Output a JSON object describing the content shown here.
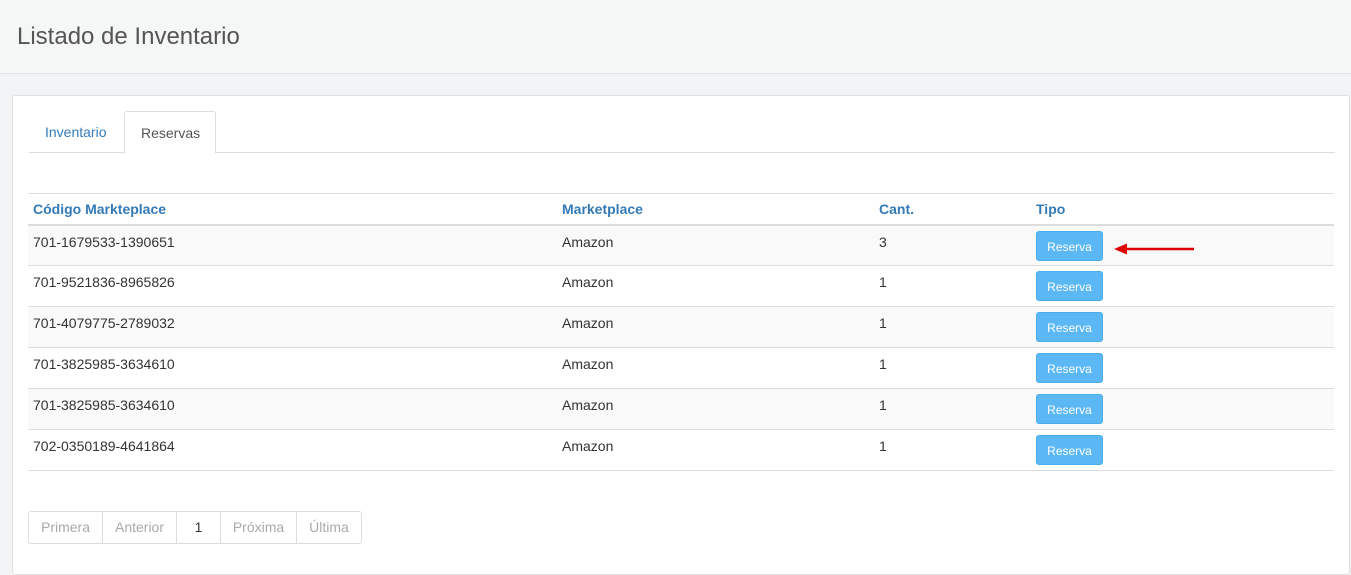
{
  "header": {
    "title": "Listado de Inventario"
  },
  "tabs": [
    {
      "label": "Inventario",
      "active": false
    },
    {
      "label": "Reservas",
      "active": true
    }
  ],
  "table": {
    "columns": [
      "Código Markteplace",
      "Marketplace",
      "Cant.",
      "Tipo"
    ],
    "rows": [
      {
        "code": "701-1679533-1390651",
        "marketplace": "Amazon",
        "qty": "3",
        "type": "Reserva"
      },
      {
        "code": "701-9521836-8965826",
        "marketplace": "Amazon",
        "qty": "1",
        "type": "Reserva"
      },
      {
        "code": "701-4079775-2789032",
        "marketplace": "Amazon",
        "qty": "1",
        "type": "Reserva"
      },
      {
        "code": "701-3825985-3634610",
        "marketplace": "Amazon",
        "qty": "1",
        "type": "Reserva"
      },
      {
        "code": "701-3825985-3634610",
        "marketplace": "Amazon",
        "qty": "1",
        "type": "Reserva"
      },
      {
        "code": "702-0350189-4641864",
        "marketplace": "Amazon",
        "qty": "1",
        "type": "Reserva"
      }
    ]
  },
  "pagination": {
    "first": "Primera",
    "prev": "Anterior",
    "current": "1",
    "next": "Próxima",
    "last": "Última"
  },
  "annotation": {
    "icon": "red-arrow-left-icon",
    "color": "#e00000"
  },
  "colors": {
    "link": "#337ab7",
    "button": "#5cb8f5"
  }
}
